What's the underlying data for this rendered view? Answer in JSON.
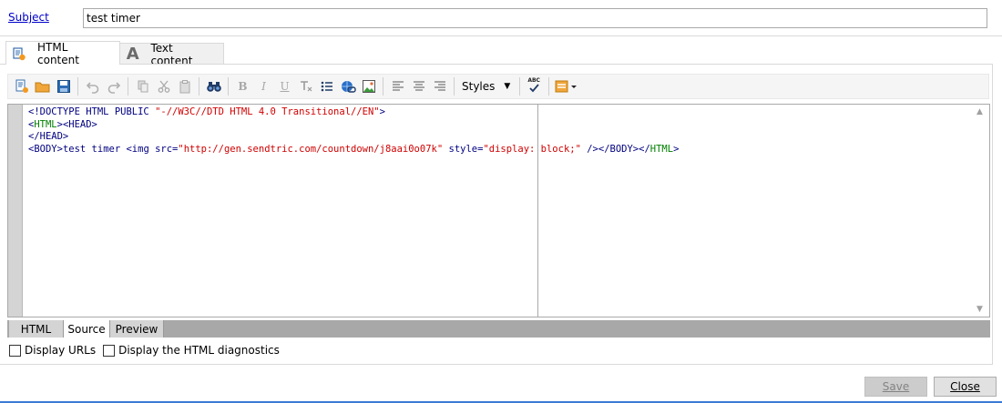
{
  "subject": {
    "label": "Subject",
    "value": "test timer"
  },
  "content_tabs": [
    {
      "label": "HTML content",
      "selected": true
    },
    {
      "label": "Text content",
      "selected": false
    }
  ],
  "toolbar": {
    "buttons": [
      "new-icon",
      "open-folder-icon",
      "save-disk-icon",
      "undo-icon",
      "redo-icon",
      "copy-icon",
      "cut-icon",
      "paste-icon",
      "find-binoculars-icon",
      "bold-icon",
      "italic-icon",
      "underline-icon",
      "clear-format-icon",
      "bullet-list-icon",
      "link-icon",
      "image-icon",
      "align-left-icon",
      "align-center-icon",
      "align-right-icon",
      "spellcheck-icon",
      "personalization-icon"
    ],
    "styles_label": "Styles",
    "bold_glyph": "B",
    "italic_glyph": "I",
    "underline_glyph": "U",
    "abc_glyph": "ABC"
  },
  "source": {
    "line1_tag": "<!DOCTYPE HTML PUBLIC ",
    "line1_str": "\"-//W3C//DTD HTML 4.0 Transitional//EN\"",
    "line1_end": ">",
    "line2_a": "<",
    "line2_b": "HTML",
    "line2_c": "><HEAD>",
    "line3": "</HEAD>",
    "line4_a": "<BODY>",
    "line4_b": "test timer",
    "line4_c": " <img src=",
    "line4_d": "\"http://gen.sendtric.com/countdown/j8aai0o07k\"",
    "line4_e": " style=",
    "line4_f": "\"display: block;\"",
    "line4_g": " /></BODY></",
    "line4_h": "HTML",
    "line4_i": ">"
  },
  "view_tabs": [
    {
      "label": "HTML",
      "selected": false
    },
    {
      "label": "Source",
      "selected": true
    },
    {
      "label": "Preview",
      "selected": false
    }
  ],
  "options": {
    "display_urls": {
      "label": "Display URLs",
      "checked": false
    },
    "display_diagnostics": {
      "label": "Display the HTML diagnostics",
      "checked": false
    }
  },
  "footer": {
    "save_label": "Save",
    "close_label": "Close",
    "save_enabled": false
  },
  "colors": {
    "tag": "#008000",
    "string": "#d00000",
    "text": "#000080",
    "accent": "#3b7bd4"
  }
}
